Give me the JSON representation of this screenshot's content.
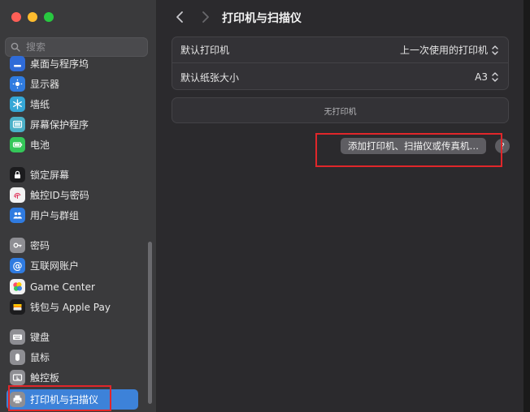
{
  "window": {
    "traffic_lights": {
      "close_color": "#ff5f57",
      "minimize_color": "#febc2e",
      "zoom_color": "#28c840"
    }
  },
  "search": {
    "placeholder": "搜索"
  },
  "sidebar": {
    "items": [
      {
        "label": "桌面与程序坞",
        "icon": "dock-icon",
        "color": "#2f6bd8"
      },
      {
        "label": "显示器",
        "icon": "sun-icon",
        "color": "#2f7be0"
      },
      {
        "label": "墙纸",
        "icon": "snowflake-icon",
        "color": "#35a7d6"
      },
      {
        "label": "屏幕保护程序",
        "icon": "screensaver-icon",
        "color": "#4ab0c8"
      },
      {
        "label": "电池",
        "icon": "battery-icon",
        "color": "#34c759"
      },
      {
        "label": "锁定屏幕",
        "icon": "lock-icon",
        "color": "#1c1c1e"
      },
      {
        "label": "触控ID与密码",
        "icon": "fingerprint-icon",
        "color": "#f2f2f2"
      },
      {
        "label": "用户与群组",
        "icon": "users-icon",
        "color": "#2f7be0"
      },
      {
        "label": "密码",
        "icon": "key-icon",
        "color": "#8e8e93"
      },
      {
        "label": "互联网账户",
        "icon": "at-icon",
        "color": "#2f7be0"
      },
      {
        "label": "Game Center",
        "icon": "game-center-icon",
        "color": "#f2f2f2"
      },
      {
        "label": "钱包与 Apple Pay",
        "icon": "wallet-icon",
        "color": "#1c1c1e"
      },
      {
        "label": "键盘",
        "icon": "keyboard-icon",
        "color": "#8e8e93"
      },
      {
        "label": "鼠标",
        "icon": "mouse-icon",
        "color": "#8e8e93"
      },
      {
        "label": "触控板",
        "icon": "trackpad-icon",
        "color": "#8e8e93"
      },
      {
        "label": "打印机与扫描仪",
        "icon": "printer-icon",
        "color": "#8e8e93",
        "selected": true
      }
    ],
    "selected_color": "#3d82d9"
  },
  "toolbar": {
    "title": "打印机与扫描仪"
  },
  "settings": {
    "default_printer": {
      "label": "默认打印机",
      "value": "上一次使用的打印机"
    },
    "default_paper": {
      "label": "默认纸张大小",
      "value": "A3"
    }
  },
  "printers": {
    "empty_text": "无打印机"
  },
  "actions": {
    "add_label": "添加打印机、扫描仪或传真机…",
    "help_label": "?"
  },
  "highlight_color": "#e0262a"
}
